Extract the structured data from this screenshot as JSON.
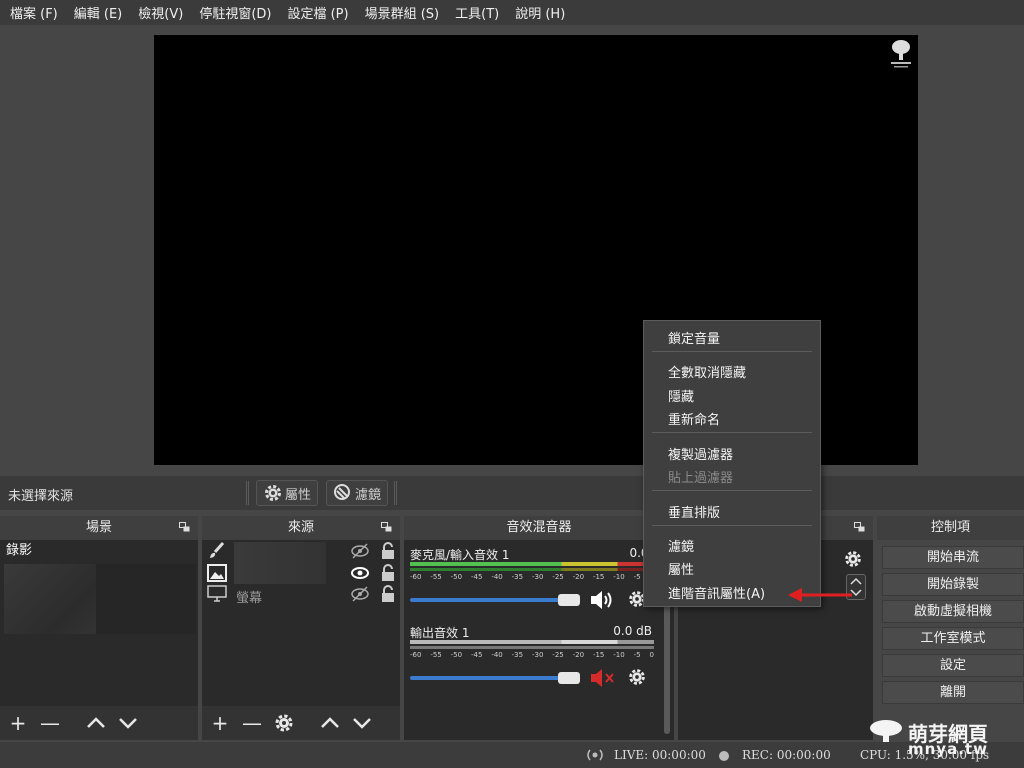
{
  "menu": [
    "檔案 (F)",
    "編輯 (E)",
    "檢視(V)",
    "停駐視窗(D)",
    "設定檔 (P)",
    "場景群組 (S)",
    "工具(T)",
    "說明 (H)"
  ],
  "source_bar": {
    "no_source": "未選擇來源",
    "properties": "屬性",
    "filters": "濾鏡"
  },
  "scenes": {
    "title": "場景",
    "items": [
      "錄影"
    ]
  },
  "sources": {
    "title": "來源",
    "items": [
      {
        "name": "",
        "icon": "brush-icon"
      },
      {
        "name": "",
        "icon": "image-icon"
      },
      {
        "name": "螢幕",
        "icon": "monitor-icon"
      }
    ]
  },
  "mixer": {
    "title": "音效混音器",
    "channels": [
      {
        "name": "麥克風/輸入音效 1",
        "db": "0.0 d",
        "level": 1.0,
        "muted": false
      },
      {
        "name": "輸出音效 1",
        "db": "0.0 dB",
        "level": 1.0,
        "muted": true
      }
    ],
    "ticks": [
      "-60",
      "-55",
      "-50",
      "-45",
      "-40",
      "-35",
      "-30",
      "-25",
      "-20",
      "-15",
      "-10",
      "-5",
      "0"
    ]
  },
  "controls": {
    "title": "控制項",
    "buttons": [
      "開始串流",
      "開始錄製",
      "啟動虛擬相機",
      "工作室模式",
      "設定",
      "離開"
    ]
  },
  "status": {
    "live": "LIVE: 00:00:00",
    "rec": "REC: 00:00:00",
    "cpu": "CPU: 1.5%, 30.00 fps"
  },
  "context_menu": {
    "items": [
      {
        "label": "鎖定音量",
        "disabled": false
      },
      {
        "label": "全數取消隱藏",
        "disabled": false
      },
      {
        "label": "隱藏",
        "disabled": false
      },
      {
        "label": "重新命名",
        "disabled": false
      },
      {
        "label": "複製過濾器",
        "disabled": false
      },
      {
        "label": "貼上過濾器",
        "disabled": true
      },
      {
        "label": "垂直排版",
        "disabled": false
      },
      {
        "label": "濾鏡",
        "disabled": false
      },
      {
        "label": "屬性",
        "disabled": false
      },
      {
        "label": "進階音訊屬性(A)",
        "disabled": false
      }
    ]
  },
  "watermark": {
    "title": "萌芽網頁",
    "sub": "mnya.tw"
  },
  "colors": {
    "accent": "#3b7bd0",
    "arrow": "#e02020",
    "mute": "#d62b2b"
  }
}
